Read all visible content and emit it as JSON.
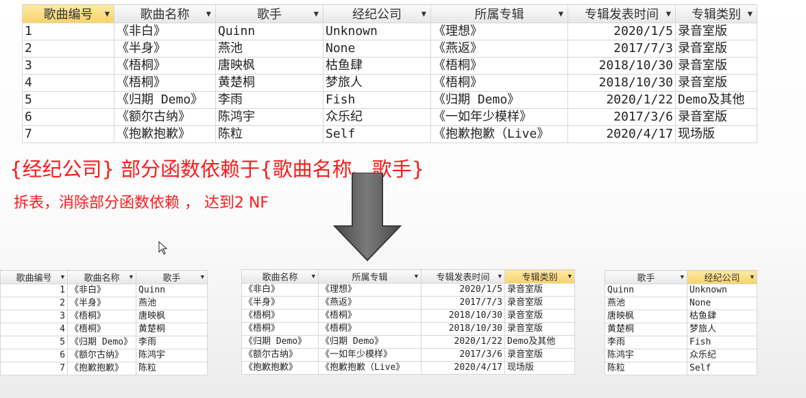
{
  "main_table": {
    "headers": [
      "歌曲编号",
      "歌曲名称",
      "歌手",
      "经纪公司",
      "所属专辑",
      "专辑发表时间",
      "专辑类别"
    ],
    "rows": [
      [
        "1",
        "《非白》",
        "Quinn",
        "Unknown",
        "《理想》",
        "2020/1/5",
        "录音室版"
      ],
      [
        "2",
        "《半身》",
        "燕池",
        "None",
        "《燕返》",
        "2017/7/3",
        "录音室版"
      ],
      [
        "3",
        "《梧桐》",
        "唐映枫",
        "枯鱼肆",
        "《梧桐》",
        "2018/10/30",
        "录音室版"
      ],
      [
        "4",
        "《梧桐》",
        "黄楚桐",
        "梦旅人",
        "《梧桐》",
        "2018/10/30",
        "录音室版"
      ],
      [
        "5",
        "《归期 Demo》",
        "李雨",
        "Fish",
        "《归期 Demo》",
        "2020/1/22",
        "Demo及其他"
      ],
      [
        "6",
        "《额尔古纳》",
        "陈鸿宇",
        "众乐纪",
        "《一如年少模样》",
        "2017/3/6",
        "录音室版"
      ],
      [
        "7",
        "《抱歉抱歉》",
        "陈粒",
        "Self",
        "《抱歉抱歉（Live》",
        "2020/4/17",
        "现场版"
      ]
    ]
  },
  "caption": {
    "line1": "{经纪公司} 部分函数依赖于{歌曲名称、歌手}",
    "line2": "拆表，消除部分函数依赖 ， 达到2 NF"
  },
  "song_table": {
    "headers": [
      "歌曲编号",
      "歌曲名称",
      "歌手"
    ],
    "rows": [
      [
        "1",
        "《非白》",
        "Quinn"
      ],
      [
        "2",
        "《半身》",
        "燕池"
      ],
      [
        "3",
        "《梧桐》",
        "唐映枫"
      ],
      [
        "4",
        "《梧桐》",
        "黄楚桐"
      ],
      [
        "5",
        "《归期 Demo》",
        "李雨"
      ],
      [
        "6",
        "《额尔古纳》",
        "陈鸿宇"
      ],
      [
        "7",
        "《抱歉抱歉》",
        "陈粒"
      ]
    ]
  },
  "album_table": {
    "headers": [
      "歌曲名称",
      "所属专辑",
      "专辑发表时间",
      "专辑类别"
    ],
    "rows": [
      [
        "《非白》",
        "《理想》",
        "2020/1/5",
        "录音室版"
      ],
      [
        "《半身》",
        "《燕返》",
        "2017/7/3",
        "录音室版"
      ],
      [
        "《梧桐》",
        "《梧桐》",
        "2018/10/30",
        "录音室版"
      ],
      [
        "《梧桐》",
        "《梧桐》",
        "2018/10/30",
        "录音室版"
      ],
      [
        "《归期 Demo》",
        "《归期 Demo》",
        "2020/1/22",
        "Demo及其他"
      ],
      [
        "《额尔古纳》",
        "《一如年少模样》",
        "2017/3/6",
        "录音室版"
      ],
      [
        "《抱歉抱歉》",
        "《抱歉抱歉（Live》",
        "2020/4/17",
        "现场版"
      ]
    ]
  },
  "company_table": {
    "headers": [
      "歌手",
      "经纪公司"
    ],
    "rows": [
      [
        "Quinn",
        "Unknown"
      ],
      [
        "燕池",
        "None"
      ],
      [
        "唐映枫",
        "枯鱼肆"
      ],
      [
        "黄楚桐",
        "梦旅人"
      ],
      [
        "李雨",
        "Fish"
      ],
      [
        "陈鸿宇",
        "众乐纪"
      ],
      [
        "陈粒",
        "Self"
      ]
    ]
  },
  "icons": {
    "dropdown": "dropdown-arrow-icon",
    "arrow": "down-arrow-icon",
    "cursor": "mouse-cursor-icon"
  },
  "colors": {
    "caption": "#ff1a1a",
    "selected_header": "#f9d267",
    "arrow_fill": "#5e5e5e"
  }
}
